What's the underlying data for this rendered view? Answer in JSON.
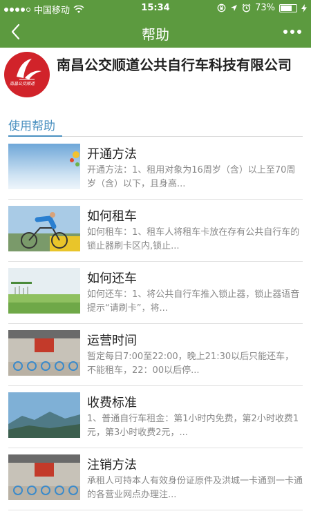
{
  "status_bar": {
    "carrier": "中国移动",
    "time": "15:34",
    "battery": "73%",
    "battery_level": 0.73,
    "icons": [
      "signal-dots-icon",
      "wifi-icon",
      "orientation-lock-icon",
      "location-arrow-icon",
      "alarm-icon",
      "battery-icon",
      "charging-icon"
    ]
  },
  "nav": {
    "title": "帮助",
    "back_icon": "chevron-left-icon",
    "more_icon": "more-dots-icon"
  },
  "company": {
    "name": "南昌公交顺道公共自行车科技有限公司",
    "logo_text": "南昌公交顺道"
  },
  "section": {
    "label": "使用帮助"
  },
  "colors": {
    "brand_green": "#5c9a3f",
    "accent_blue": "#4a90c0",
    "logo_red": "#d1232a"
  },
  "items": [
    {
      "title": "开通方法",
      "desc": "开通方法：1、租用对象为16周岁（含）以上至70周岁（含）以下，且身高..."
    },
    {
      "title": "如何租车",
      "desc": "如何租车：1、租车人将租车卡放在存有公共自行车的锁止器刷卡区内,锁止..."
    },
    {
      "title": "如何还车",
      "desc": "如何还车：1、将公共自行车推入锁止器，锁止器语音提示“请刷卡”，将..."
    },
    {
      "title": "运营时间",
      "desc": "暂定每日7:00至22:00，晚上21:30以后只能还车，不能租车，22：00以后停..."
    },
    {
      "title": "收费标准",
      "desc": "1、普通自行车租金：第1小时内免费，第2小时收费1元，第3小时收费2元，..."
    },
    {
      "title": "注销方法",
      "desc": "承租人可持本人有效身份证原件及洪城一卡通到一卡通的各营业网点办理注..."
    }
  ]
}
